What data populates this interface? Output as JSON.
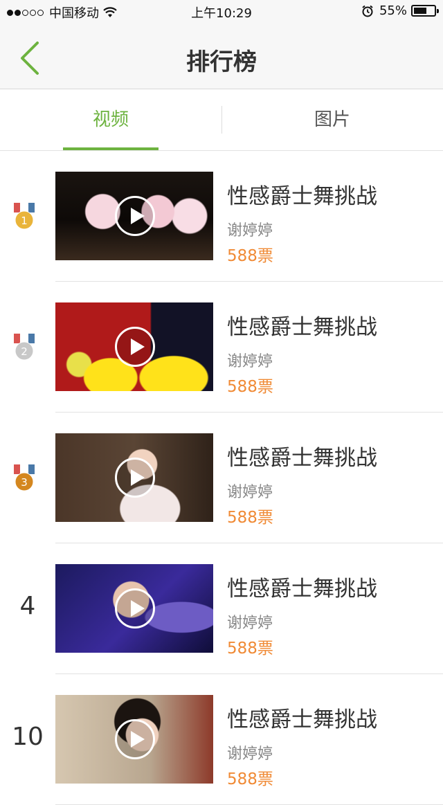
{
  "status_bar": {
    "carrier": "中国移动",
    "time": "上午10:29",
    "battery": "55%",
    "signal_icon": "signal-dots-icon",
    "wifi_icon": "wifi-icon",
    "alarm_icon": "alarm-clock-icon",
    "battery_icon": "battery-icon"
  },
  "nav": {
    "title": "排行榜",
    "back_icon": "chevron-left-icon"
  },
  "tabs": [
    {
      "label": "视频",
      "active": true
    },
    {
      "label": "图片",
      "active": false
    }
  ],
  "colors": {
    "accent": "#6db33f",
    "votes": "#f08a35",
    "gold": "#e9b43a",
    "silver": "#c8c8c8",
    "bronze": "#d4871f"
  },
  "items": [
    {
      "rank": "1",
      "medal": "gold",
      "title": "性感爵士舞挑战",
      "author": "谢婷婷",
      "votes": "588票"
    },
    {
      "rank": "2",
      "medal": "silver",
      "title": "性感爵士舞挑战",
      "author": "谢婷婷",
      "votes": "588票"
    },
    {
      "rank": "3",
      "medal": "bronze",
      "title": "性感爵士舞挑战",
      "author": "谢婷婷",
      "votes": "588票"
    },
    {
      "rank": "4",
      "medal": "",
      "title": "性感爵士舞挑战",
      "author": "谢婷婷",
      "votes": "588票"
    },
    {
      "rank": "10",
      "medal": "",
      "title": "性感爵士舞挑战",
      "author": "谢婷婷",
      "votes": "588票"
    }
  ]
}
